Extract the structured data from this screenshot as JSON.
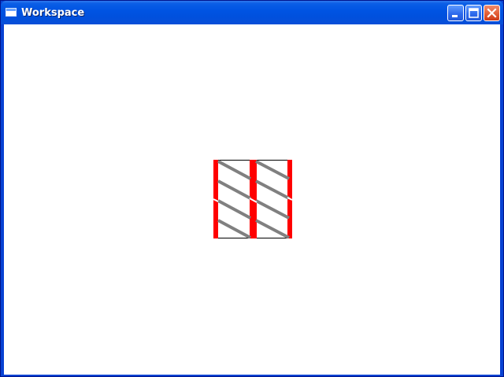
{
  "window": {
    "title": "Workspace",
    "icons": {
      "app": "window-icon",
      "minimize": "minimize-icon",
      "maximize": "maximize-icon",
      "close": "close-icon"
    }
  },
  "colors": {
    "frame": "#0842d3",
    "titlebar": "#0054e3",
    "client_background": "#ffffff",
    "pattern_stripe": "#ff0000",
    "pattern_lines": "#808080",
    "pattern_border": "#000000"
  }
}
